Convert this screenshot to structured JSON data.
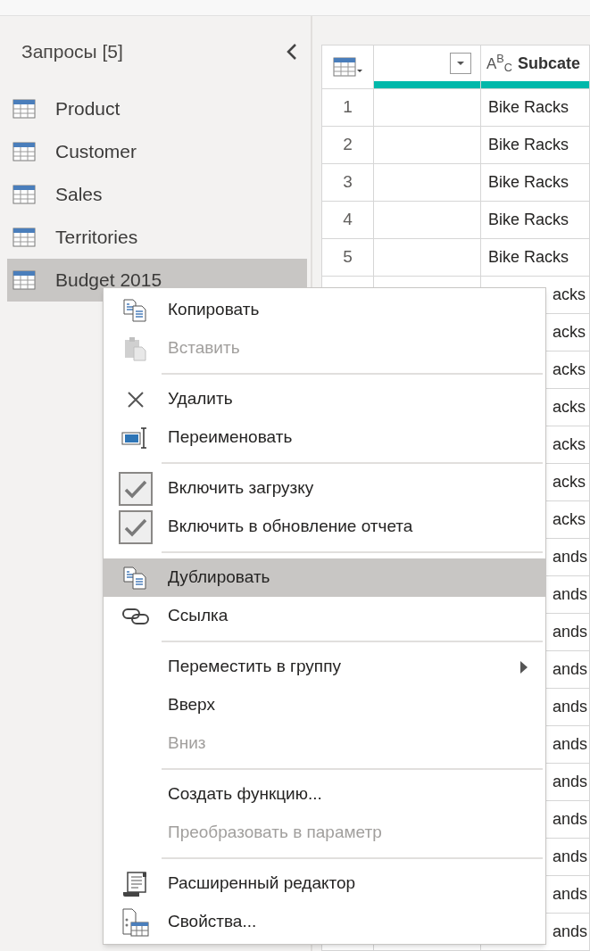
{
  "sidebar": {
    "title": "Запросы [5]",
    "items": [
      {
        "label": "Product",
        "selected": false
      },
      {
        "label": "Customer",
        "selected": false
      },
      {
        "label": "Sales",
        "selected": false
      },
      {
        "label": "Territories",
        "selected": false
      },
      {
        "label": "Budget 2015",
        "selected": true
      }
    ]
  },
  "grid": {
    "column_3_type": "A$^{B}$$_{C}$",
    "column_3_header": "Subcate",
    "rows": [
      {
        "row_number": "1",
        "column_3": "Bike Racks"
      },
      {
        "row_number": "2",
        "column_3": "Bike Racks"
      },
      {
        "row_number": "3",
        "column_3": "Bike Racks"
      },
      {
        "row_number": "4",
        "column_3": "Bike Racks"
      },
      {
        "row_number": "5",
        "column_3": "Bike Racks"
      },
      {
        "column_3": "acks"
      },
      {
        "column_3": "acks"
      },
      {
        "column_3": "acks"
      },
      {
        "column_3": "acks"
      },
      {
        "column_3": "acks"
      },
      {
        "column_3": "acks"
      },
      {
        "column_3": "acks"
      },
      {
        "column_3": "ands"
      },
      {
        "column_3": "ands"
      },
      {
        "column_3": "ands"
      },
      {
        "column_3": "ands"
      },
      {
        "column_3": "ands"
      },
      {
        "column_3": "ands"
      },
      {
        "column_3": "ands"
      },
      {
        "column_3": "ands"
      },
      {
        "column_3": "ands"
      },
      {
        "column_3": "ands"
      },
      {
        "column_3": "ands"
      }
    ]
  },
  "context_menu": {
    "groups": [
      [
        {
          "kind": "command",
          "label": "Копировать",
          "disabled": false,
          "selected": false
        },
        {
          "kind": "command",
          "label": "Вставить",
          "disabled": true,
          "selected": false
        }
      ],
      [
        {
          "kind": "command",
          "label": "Удалить",
          "disabled": false,
          "selected": false
        },
        {
          "kind": "command",
          "label": "Переименовать",
          "disabled": false,
          "selected": false
        }
      ],
      [
        {
          "kind": "toggle",
          "label": "Включить загрузку",
          "checked": true,
          "disabled": false,
          "selected": false
        },
        {
          "kind": "toggle",
          "label": "Включить в обновление отчета",
          "checked": true,
          "disabled": false,
          "selected": false
        }
      ],
      [
        {
          "kind": "command",
          "label": "Дублировать",
          "disabled": false,
          "selected": true
        },
        {
          "kind": "command",
          "label": "Ссылка",
          "disabled": false,
          "selected": false
        }
      ],
      [
        {
          "kind": "submenu",
          "label": "Переместить в группу",
          "disabled": false,
          "selected": false
        },
        {
          "kind": "command",
          "label": "Вверх",
          "disabled": false,
          "selected": false
        },
        {
          "kind": "command",
          "label": "Вниз",
          "disabled": true,
          "selected": false
        }
      ],
      [
        {
          "kind": "command",
          "label": "Создать функцию...",
          "disabled": false,
          "selected": false
        },
        {
          "kind": "command",
          "label": "Преобразовать в параметр",
          "disabled": true,
          "selected": false
        }
      ],
      [
        {
          "kind": "command",
          "label": "Расширенный редактор",
          "disabled": false,
          "selected": false
        },
        {
          "kind": "command",
          "label": "Свойства...",
          "disabled": false,
          "selected": false
        }
      ]
    ]
  }
}
